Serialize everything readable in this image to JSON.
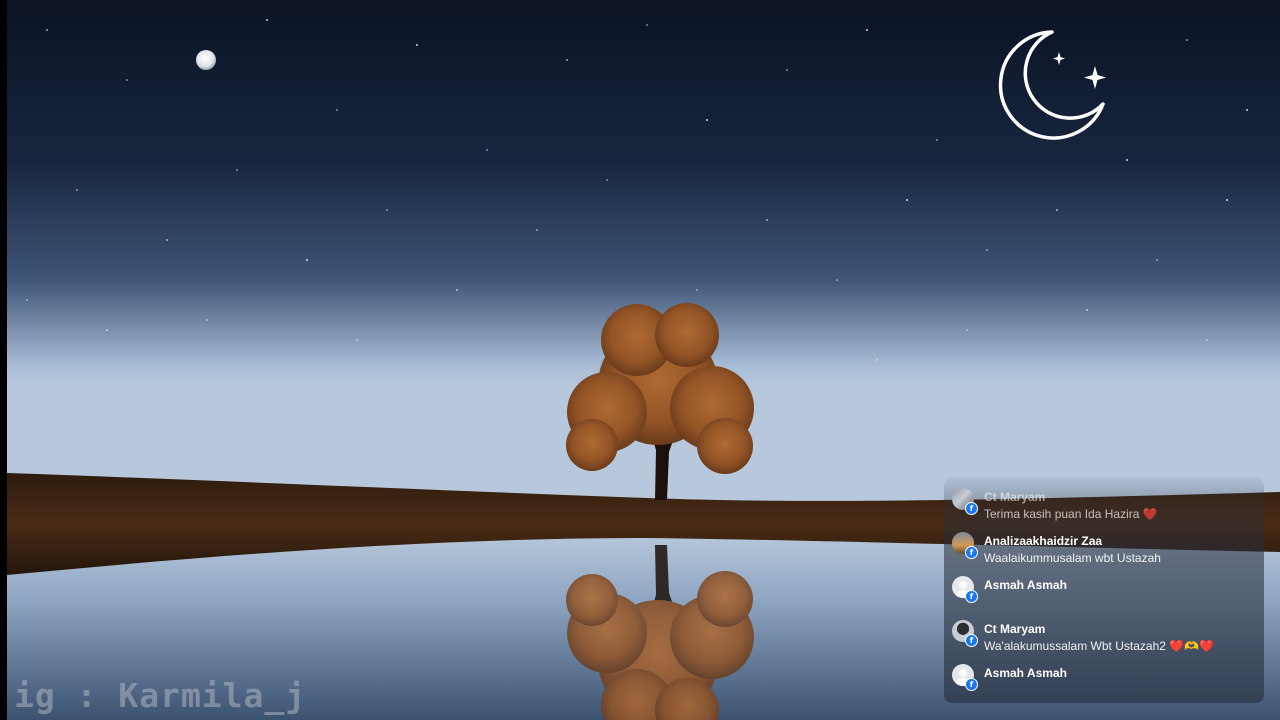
{
  "watermark": {
    "text": "ig : Karmila_j"
  },
  "logo": {
    "icon": "crescent-moon-stars-icon",
    "color": "#ffffff"
  },
  "scene": {
    "sky_top": "#0c1425",
    "sky_horizon": "#a9bfd6",
    "ground": "#3b2413",
    "foliage": "#9a5a2a"
  },
  "comments": {
    "items": [
      {
        "name": "Ct Maryam",
        "text": "Terima kasih puan Ida Hazira ❤️",
        "avatar": "photo",
        "platform_icon": "facebook-icon"
      },
      {
        "name": "Analizaakhaidzir Zaa",
        "text": "Waalaikummusalam wbt Ustazah",
        "avatar": "photo",
        "platform_icon": "facebook-icon"
      },
      {
        "name": "Asmah Asmah",
        "text": "",
        "avatar": "default",
        "platform_icon": "facebook-icon"
      },
      {
        "name": "Ct Maryam",
        "text": "Wa'alakumussalam Wbt Ustazah2 ❤️🫶❤️",
        "avatar": "photo",
        "platform_icon": "facebook-icon"
      },
      {
        "name": "Asmah Asmah",
        "text": "",
        "avatar": "default",
        "platform_icon": "facebook-icon"
      }
    ]
  }
}
